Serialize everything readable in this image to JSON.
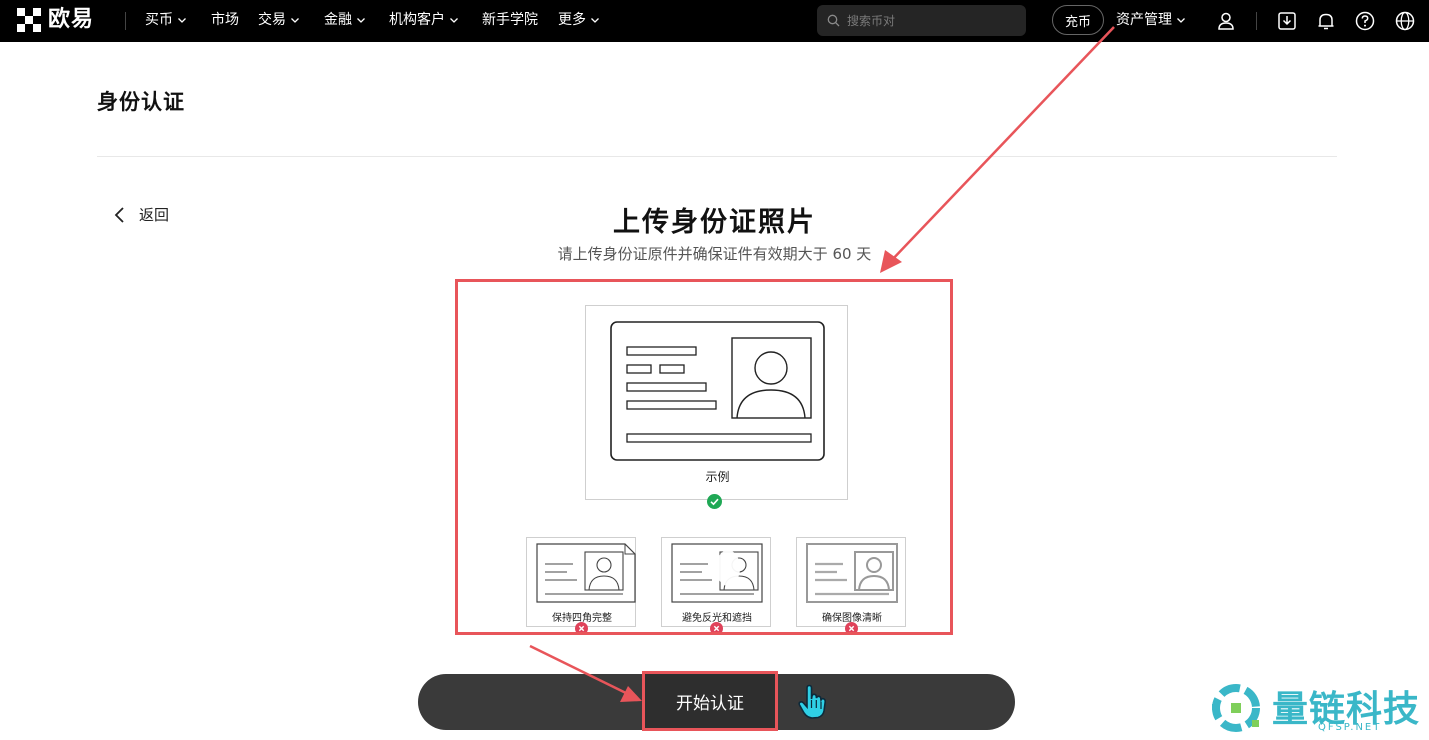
{
  "nav": {
    "brand": "欧易",
    "items": [
      {
        "label": "买币",
        "dropdown": true
      },
      {
        "label": "市场",
        "dropdown": false
      },
      {
        "label": "交易",
        "dropdown": true
      },
      {
        "label": "金融",
        "dropdown": true
      },
      {
        "label": "机构客户",
        "dropdown": true
      },
      {
        "label": "新手学院",
        "dropdown": false
      },
      {
        "label": "更多",
        "dropdown": true
      }
    ],
    "search_placeholder": "搜索币对",
    "deposit_label": "充币",
    "assets_label": "资产管理",
    "icons": [
      "user-icon",
      "download-icon",
      "bell-icon",
      "help-icon",
      "globe-icon"
    ]
  },
  "page": {
    "title": "身份认证",
    "back_label": "返回",
    "heading": "上传身份证照片",
    "subtitle": "请上传身份证原件并确保证件有效期大于 60 天"
  },
  "example": {
    "label": "示例",
    "status": "ok"
  },
  "samples": [
    {
      "label": "保持四角完整",
      "status": "bad"
    },
    {
      "label": "避免反光和遮挡",
      "status": "bad"
    },
    {
      "label": "确保图像清晰",
      "status": "bad"
    }
  ],
  "action": {
    "start_label": "开始认证"
  },
  "watermark": {
    "text": "量链科技",
    "sub": "QFSP.NET"
  },
  "colors": {
    "nav_bg": "#000000",
    "highlight_red": "#e8555a",
    "ok_green": "#1fa855",
    "bad_red": "#e0425a",
    "watermark": "#3ab7c8",
    "button_bg": "#3a3a3a"
  }
}
